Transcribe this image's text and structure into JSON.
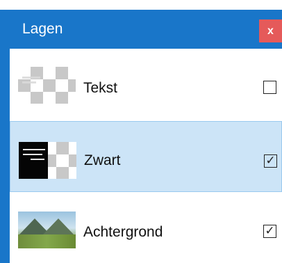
{
  "panel": {
    "title": "Lagen",
    "close_label": "x"
  },
  "layers": [
    {
      "name": "Tekst",
      "checked": false,
      "check_mark": ""
    },
    {
      "name": "Zwart",
      "checked": true,
      "check_mark": "✓"
    },
    {
      "name": "Achtergrond",
      "checked": true,
      "check_mark": "✓"
    }
  ],
  "colors": {
    "header": "#1976c9",
    "selected_row": "#cce4f7",
    "close_button": "#e55a5a"
  }
}
